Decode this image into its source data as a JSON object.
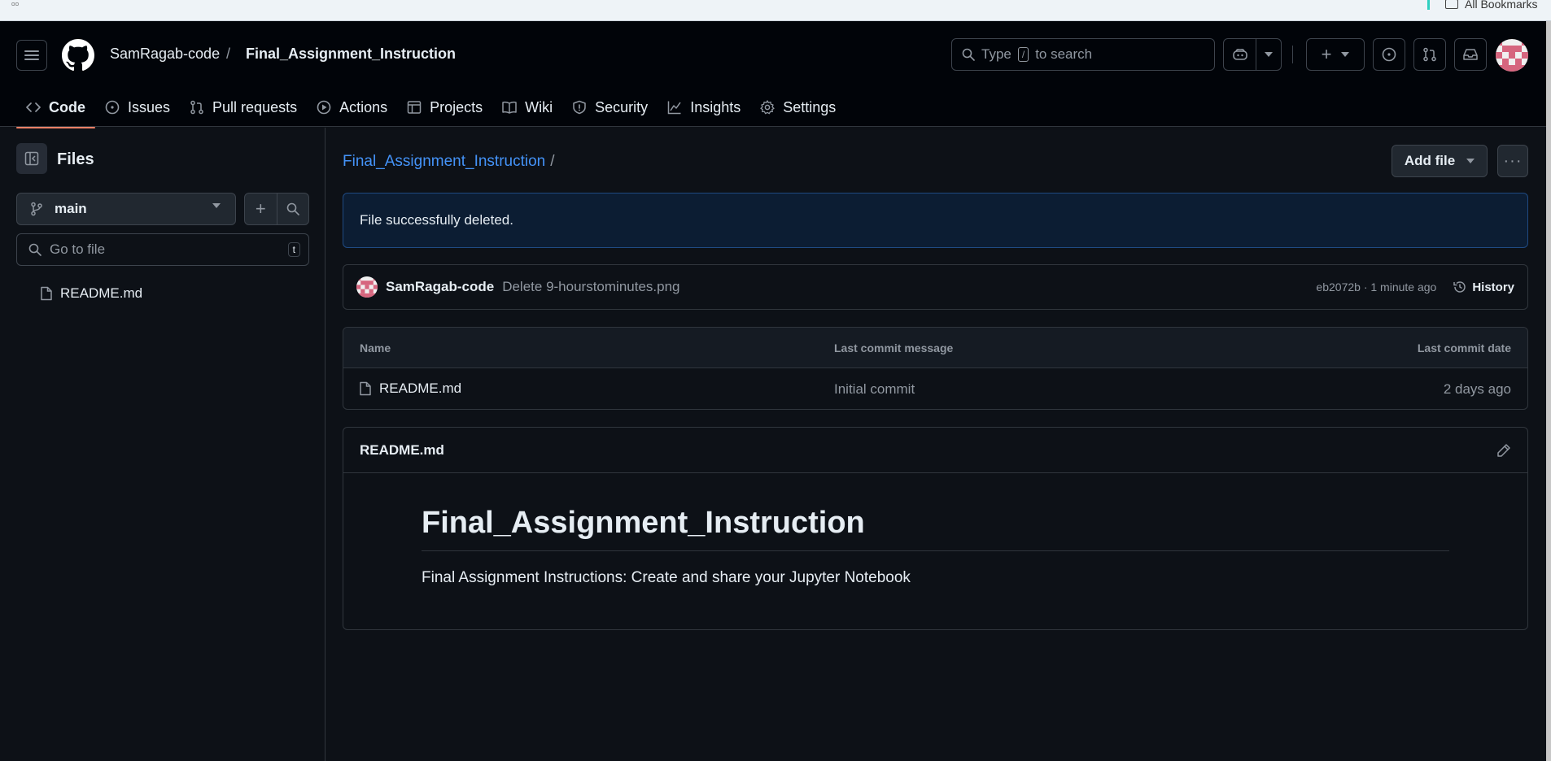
{
  "browser": {
    "all_bookmarks": "All Bookmarks"
  },
  "header": {
    "owner": "SamRagab-code",
    "separator": "/",
    "repo": "Final_Assignment_Instruction",
    "search_prefix": "Type",
    "search_key": "/",
    "search_suffix": "to search"
  },
  "tabs": [
    {
      "label": "Code",
      "icon": "code-icon",
      "active": true
    },
    {
      "label": "Issues",
      "icon": "issue-icon"
    },
    {
      "label": "Pull requests",
      "icon": "pull-request-icon"
    },
    {
      "label": "Actions",
      "icon": "play-icon"
    },
    {
      "label": "Projects",
      "icon": "table-icon"
    },
    {
      "label": "Wiki",
      "icon": "book-icon"
    },
    {
      "label": "Security",
      "icon": "shield-icon"
    },
    {
      "label": "Insights",
      "icon": "graph-icon"
    },
    {
      "label": "Settings",
      "icon": "gear-icon"
    }
  ],
  "sidebar": {
    "title": "Files",
    "branch": "main",
    "goto_placeholder": "Go to file",
    "goto_shortcut": "t",
    "items": [
      {
        "label": "README.md"
      }
    ]
  },
  "main": {
    "breadcrumb_repo": "Final_Assignment_Instruction",
    "breadcrumb_sep": "/",
    "add_file": "Add file",
    "flash": "File successfully deleted.",
    "commit": {
      "author": "SamRagab-code",
      "message": "Delete 9-hourstominutes.png",
      "sha_time": "eb2072b · 1 minute ago",
      "history": "History"
    },
    "table": {
      "headers": [
        "Name",
        "Last commit message",
        "Last commit date"
      ],
      "rows": [
        {
          "name": "README.md",
          "message": "Initial commit",
          "date": "2 days ago"
        }
      ]
    },
    "readme": {
      "filename": "README.md",
      "heading": "Final_Assignment_Instruction",
      "text": "Final Assignment Instructions: Create and share your Jupyter Notebook"
    }
  },
  "colors": {
    "bg": "#0d1117",
    "header_bg": "#010409",
    "link": "#4493f8",
    "active_tab_underline": "#f78166",
    "avatar_pink": "#d6657e"
  }
}
